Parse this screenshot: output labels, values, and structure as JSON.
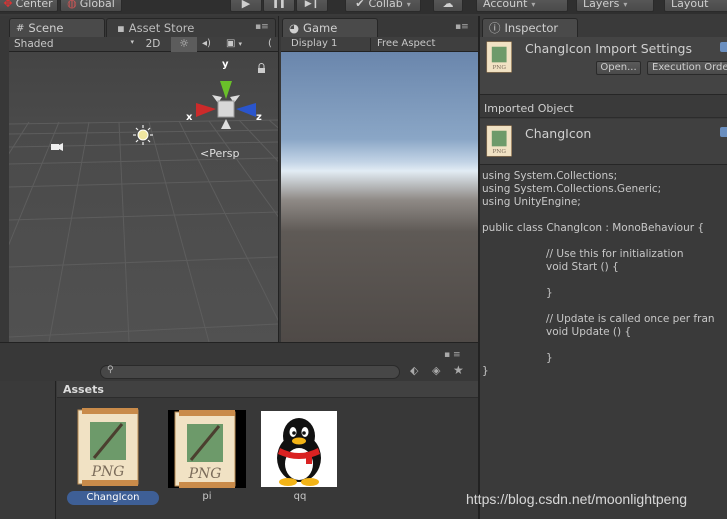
{
  "top_toolbar": {
    "center_label": "Center",
    "global_label": "Global",
    "play_icon": "▶",
    "pause_icon": "❚❚",
    "step_icon": "▶❙",
    "collab_label": "Collab",
    "account_label": "Account",
    "layers_label": "Layers",
    "layout_label": "Layout"
  },
  "scene": {
    "tab_label": "Scene",
    "asset_store_label": "Asset Store",
    "shading_mode": "Shaded",
    "mode_2d": "2D",
    "gizmo_y": "y",
    "gizmo_x": "x",
    "gizmo_z": "z",
    "persp_label": "Persp"
  },
  "game": {
    "tab_label": "Game",
    "display_label": "Display 1",
    "aspect_label": "Free Aspect"
  },
  "inspector": {
    "tab_label": "Inspector",
    "title": "ChangIcon Import Settings",
    "open_button": "Open...",
    "exec_order_button": "Execution Orde",
    "imported_object_header": "Imported Object",
    "object_name": "ChangIcon",
    "code_lines": [
      "using System.Collections;",
      "using System.Collections.Generic;",
      "using UnityEngine;",
      "",
      "public class ChangIcon : MonoBehaviour {",
      "",
      "\t\t// Use this for initialization",
      "\t\tvoid Start () {",
      "",
      "\t\t}",
      "",
      "\t\t// Update is called once per fran",
      "\t\tvoid Update () {",
      "",
      "\t\t}",
      "}"
    ]
  },
  "project": {
    "assets_header": "Assets",
    "items": [
      {
        "label": "ChangIcon",
        "selected": true,
        "icon": "png-file-icon"
      },
      {
        "label": "pi",
        "selected": false,
        "icon": "png-file-icon"
      },
      {
        "label": "qq",
        "selected": false,
        "icon": "penguin-icon"
      }
    ]
  },
  "watermark": "https://blog.csdn.net/moonlightpeng",
  "colors": {
    "accent_selected": "#3e5f96",
    "panel_bg": "#3a3a3a",
    "scene_bg": "#474747",
    "gizmo_x": "#cc2a2a",
    "gizmo_y": "#6ac02a",
    "gizmo_z": "#2a55cc"
  }
}
